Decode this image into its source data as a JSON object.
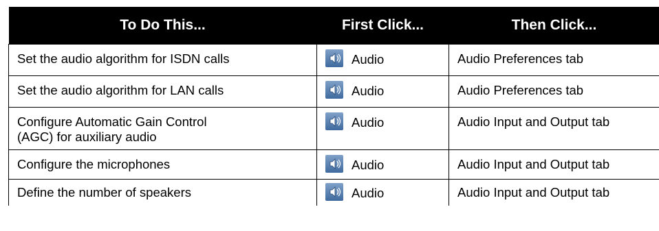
{
  "table": {
    "headers": [
      "To Do This...",
      "First Click...",
      "Then Click..."
    ],
    "rows": [
      {
        "task": "Set the audio algorithm for ISDN calls",
        "first_click": "Audio",
        "first_click_icon": "speaker-icon",
        "then_click": "Audio Preferences tab"
      },
      {
        "task": "Set the audio algorithm for LAN calls",
        "first_click": "Audio",
        "first_click_icon": "speaker-icon",
        "then_click": "Audio Preferences tab"
      },
      {
        "task_line1": "Configure Automatic Gain Control",
        "task_line2": "(AGC) for auxiliary audio",
        "first_click": "Audio",
        "first_click_icon": "speaker-icon",
        "then_click": "Audio Input and Output tab"
      },
      {
        "task": "Configure the microphones",
        "first_click": "Audio",
        "first_click_icon": "speaker-icon",
        "then_click": "Audio Input and Output tab"
      },
      {
        "task": "Define the number of speakers",
        "first_click": "Audio",
        "first_click_icon": "speaker-icon",
        "then_click": "Audio Input and Output tab"
      }
    ]
  },
  "colors": {
    "header_bg": "#000000",
    "header_text": "#ffffff",
    "icon_blue": "#4a74a8"
  }
}
